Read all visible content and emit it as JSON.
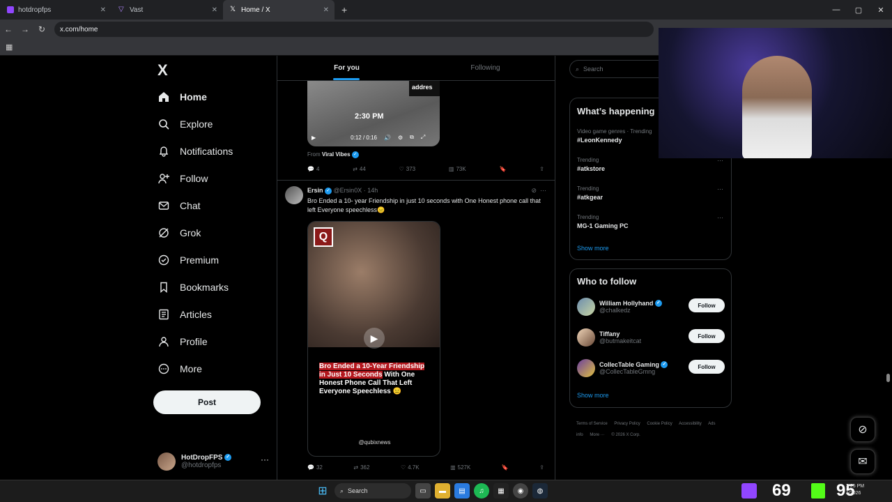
{
  "browser": {
    "tabs": [
      {
        "label": "hotdropfps"
      },
      {
        "label": "Vast"
      },
      {
        "label": "Home / X"
      }
    ],
    "url": "x.com/home"
  },
  "sidebar": {
    "logo": "X",
    "items": [
      {
        "label": "Home",
        "icon": "home-icon"
      },
      {
        "label": "Explore",
        "icon": "search-icon"
      },
      {
        "label": "Notifications",
        "icon": "bell-icon"
      },
      {
        "label": "Follow",
        "icon": "person-add-icon"
      },
      {
        "label": "Chat",
        "icon": "mail-icon"
      },
      {
        "label": "Grok",
        "icon": "grok-icon"
      },
      {
        "label": "Premium",
        "icon": "verified-icon"
      },
      {
        "label": "Bookmarks",
        "icon": "bookmark-icon"
      },
      {
        "label": "Articles",
        "icon": "article-icon"
      },
      {
        "label": "Profile",
        "icon": "person-icon"
      },
      {
        "label": "More",
        "icon": "more-circle-icon"
      }
    ],
    "post_label": "Post",
    "account": {
      "name": "HotDropFPS",
      "handle": "@hotdropfps"
    }
  },
  "feed": {
    "tabs": [
      {
        "label": "For you"
      },
      {
        "label": "Following"
      }
    ],
    "tweet1": {
      "video_overlay": "addres",
      "video_time_text": "2:30 PM",
      "video_progress": "0:12 / 0:16",
      "from_label": "From",
      "from_name": "Viral Vibes",
      "replies": "4",
      "reposts": "44",
      "likes": "373",
      "views": "73K"
    },
    "tweet2": {
      "name": "Ersin",
      "handle": "@Ersin0X",
      "time": "14h",
      "text": "Bro Ended a 10- year Friendship in just 10 seconds with One Honest phone call that left Everyone speechless😑",
      "caption_red": "Bro Ended a 10-Year Friendship in Just 10 Seconds",
      "caption_rest": " With One Honest Phone Call That Left Everyone Speechless 😑",
      "source": "@qubixnews",
      "replies": "32",
      "reposts": "362",
      "likes": "4.7K",
      "views": "527K"
    }
  },
  "right": {
    "search_placeholder": "Search",
    "happening_title": "What’s happening",
    "trends": [
      {
        "meta": "Video game genres · Trending",
        "tag": "#LeonKennedy"
      },
      {
        "meta": "Trending",
        "tag": "#atkstore"
      },
      {
        "meta": "Trending",
        "tag": "#atkgear"
      },
      {
        "meta": "Trending",
        "tag": "MG-1 Gaming PC"
      }
    ],
    "show_more": "Show more",
    "wtf_title": "Who to follow",
    "follow_label": "Follow",
    "suggestions": [
      {
        "name": "William Hollyhand",
        "handle": "@chalkedz"
      },
      {
        "name": "Tiffany",
        "handle": "@butmakeitcat"
      },
      {
        "name": "CollecTable Gaming",
        "handle": "@CollecTableGmng"
      }
    ],
    "footer": [
      "Terms of Service",
      "Privacy Policy",
      "Cookie Policy",
      "Accessibility",
      "Ads info",
      "More ···",
      "© 2026 X Corp."
    ]
  },
  "taskbar": {
    "search": "Search",
    "stat1": "69",
    "stat2": "95",
    "time": "3:25 PM",
    "date": "1/2026"
  },
  "colors": {
    "accent": "#1d9bf0",
    "bg": "#000000",
    "border": "#2f3336"
  }
}
